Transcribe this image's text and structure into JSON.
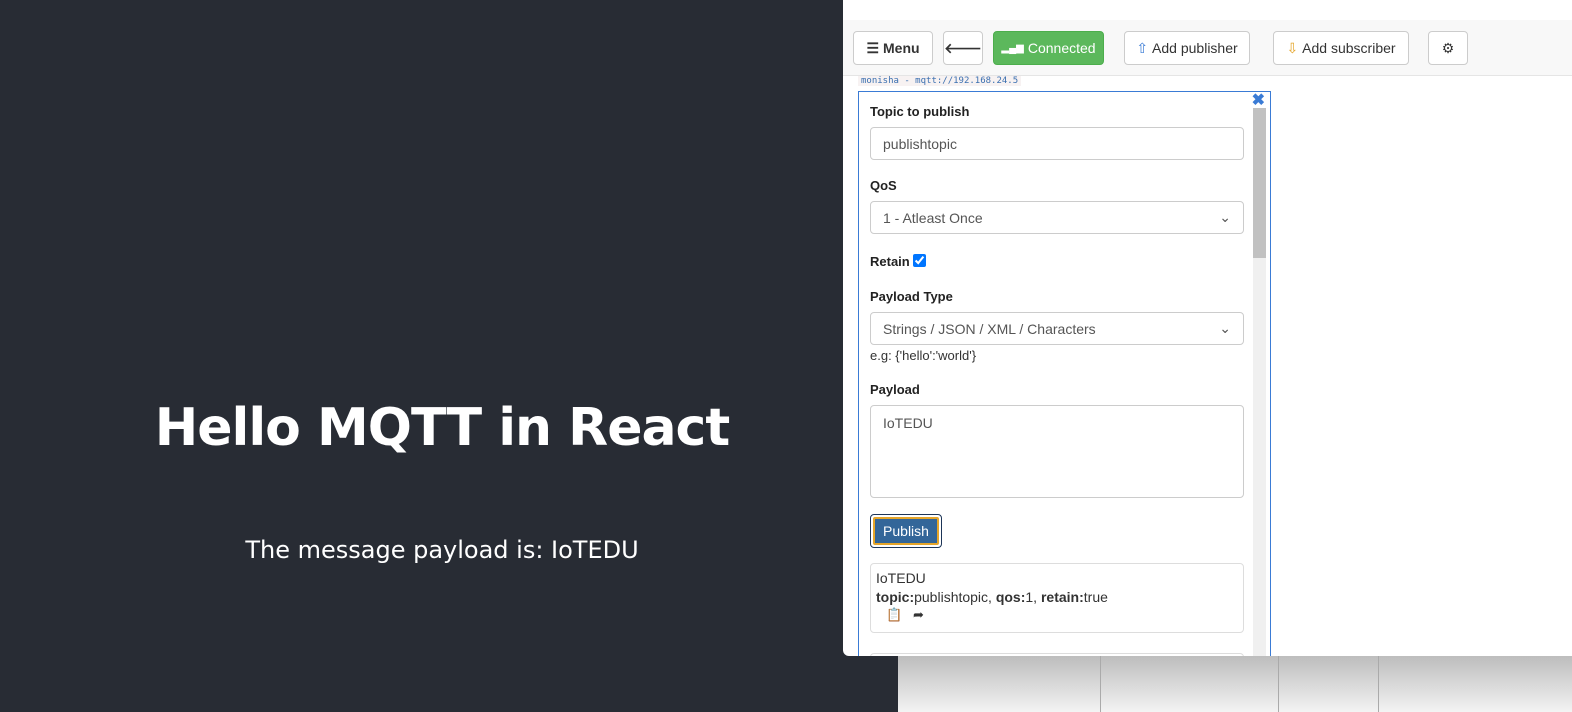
{
  "app": {
    "title": "Hello MQTT in React",
    "message": "The message payload is: IoTEDU"
  },
  "toolbar": {
    "menu": "Menu",
    "back_icon": "arrow-left-icon",
    "connected": "Connected",
    "add_publisher": "Add publisher",
    "add_subscriber": "Add subscriber",
    "settings_icon": "gear-icon"
  },
  "connection": "monisha - mqtt://192.168.24.5",
  "publisher": {
    "topic_label": "Topic to publish",
    "topic_value": "publishtopic",
    "qos_label": "QoS",
    "qos_value": "1 - Atleast Once",
    "retain_label": "Retain",
    "retain_checked": true,
    "payload_type_label": "Payload Type",
    "payload_type_value": "Strings / JSON / XML / Characters",
    "payload_hint": "e.g: {'hello':'world'}",
    "payload_label": "Payload",
    "payload_value": "IoTEDU",
    "publish_button": "Publish"
  },
  "messages": [
    {
      "payload": "IoTEDU",
      "topic_key": "topic:",
      "topic": "publishtopic, ",
      "qos_key": "qos:",
      "qos": "1, ",
      "retain_key": "retain:",
      "retain": "true"
    }
  ],
  "colors": {
    "connected": "#5cb85c",
    "publish": "#336699",
    "panel_border": "#3a7bd5",
    "background": "#282c34"
  }
}
